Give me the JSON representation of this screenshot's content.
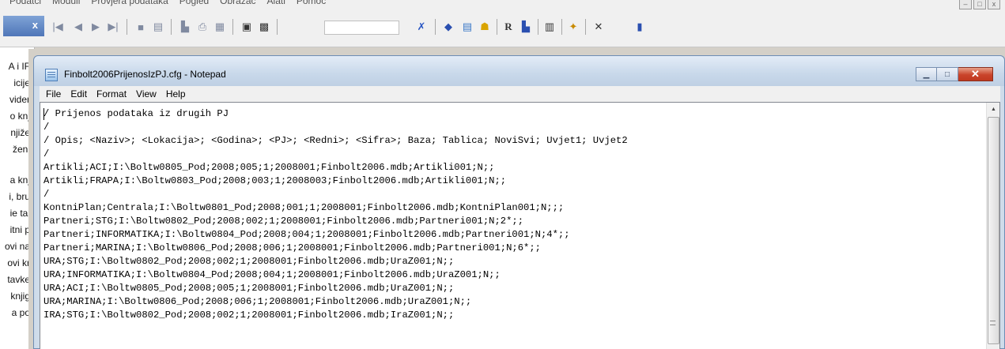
{
  "background_app": {
    "menu": [
      "Podatci",
      "Moduli",
      "Provjera podataka",
      "Pogled",
      "Obrazac",
      "Alati",
      "Pomoć"
    ],
    "close_tab_label": "x",
    "toolbar_letter": "R",
    "sidebar_rows": [
      "A i IF",
      "icije",
      "vider",
      "o knj",
      "njiže",
      "ženi",
      "a knj",
      "i, bru",
      "ie tal",
      "itni p",
      "ovi na",
      "ovi kr",
      "tavke",
      "knjig",
      "a po"
    ]
  },
  "notepad": {
    "title": "Finbolt2006PrijenosIzPJ.cfg - Notepad",
    "menu": [
      "File",
      "Edit",
      "Format",
      "View",
      "Help"
    ],
    "lines": [
      "/ Prijenos podataka iz drugih PJ",
      "/",
      "/ Opis; <Naziv>; <Lokacija>; <Godina>; <PJ>; <Redni>; <Sifra>; Baza; Tablica; NoviSvi; Uvjet1; Uvjet2",
      "/",
      "Artikli;ACI;I:\\Boltw0805_Pod;2008;005;1;2008001;Finbolt2006.mdb;Artikli001;N;;",
      "Artikli;FRAPA;I:\\Boltw0803_Pod;2008;003;1;2008003;Finbolt2006.mdb;Artikli001;N;;",
      "/",
      "KontniPlan;Centrala;I:\\Boltw0801_Pod;2008;001;1;2008001;Finbolt2006.mdb;KontniPlan001;N;;;",
      "Partneri;STG;I:\\Boltw0802_Pod;2008;002;1;2008001;Finbolt2006.mdb;Partneri001;N;2*;;",
      "Partneri;INFORMATIKA;I:\\Boltw0804_Pod;2008;004;1;2008001;Finbolt2006.mdb;Partneri001;N;4*;;",
      "Partneri;MARINA;I:\\Boltw0806_Pod;2008;006;1;2008001;Finbolt2006.mdb;Partneri001;N;6*;;",
      "URA;STG;I:\\Boltw0802_Pod;2008;002;1;2008001;Finbolt2006.mdb;UraZ001;N;;",
      "URA;INFORMATIKA;I:\\Boltw0804_Pod;2008;004;1;2008001;Finbolt2006.mdb;UraZ001;N;;",
      "URA;ACI;I:\\Boltw0805_Pod;2008;005;1;2008001;Finbolt2006.mdb;UraZ001;N;;",
      "URA;MARINA;I:\\Boltw0806_Pod;2008;006;1;2008001;Finbolt2006.mdb;UraZ001;N;;",
      "IRA;STG;I:\\Boltw0802_Pod;2008;002;1;2008001;Finbolt2006.mdb;IraZ001;N;;"
    ]
  },
  "colors": {
    "title_bar": "#c8d8ea",
    "close_button": "#c9432a",
    "editor_bg": "#ffffff"
  }
}
